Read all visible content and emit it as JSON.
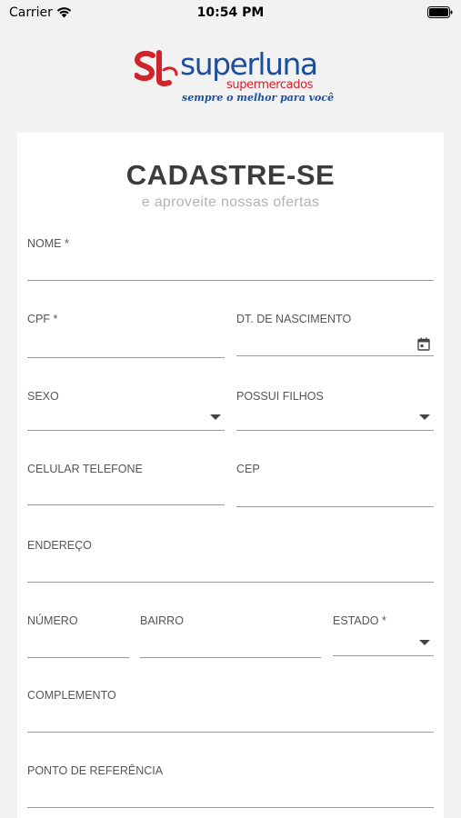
{
  "status_bar": {
    "carrier": "Carrier",
    "time": "10:54 PM",
    "wifi_icon": "wifi-icon",
    "battery_icon": "battery-icon"
  },
  "logo": {
    "name": "superluna",
    "sub": "supermercados",
    "slogan": "sempre o melhor para você",
    "mark_letters": "SL",
    "colors": {
      "red": "#d1232a",
      "blue": "#1d4e9c"
    }
  },
  "form": {
    "title": "CADASTRE-SE",
    "subtitle": "e aproveite nossas ofertas",
    "fields": {
      "nome": {
        "label": "NOME *",
        "value": ""
      },
      "cpf": {
        "label": "CPF *",
        "value": ""
      },
      "nascimento": {
        "label": "DT. DE NASCIMENTO",
        "value": "",
        "icon": "calendar-icon"
      },
      "sexo": {
        "label": "SEXO",
        "value": "",
        "icon": "dropdown-arrow-icon"
      },
      "filhos": {
        "label": "POSSUI FILHOS",
        "value": "",
        "icon": "dropdown-arrow-icon"
      },
      "celular": {
        "label": "CELULAR TELEFONE",
        "value": ""
      },
      "cep": {
        "label": "CEP",
        "value": ""
      },
      "endereco": {
        "label": "ENDEREÇO",
        "value": ""
      },
      "numero": {
        "label": "NÚMERO",
        "value": ""
      },
      "bairro": {
        "label": "BAIRRO",
        "value": ""
      },
      "estado": {
        "label": "ESTADO *",
        "value": "",
        "icon": "dropdown-arrow-icon"
      },
      "complemento": {
        "label": "COMPLEMENTO",
        "value": ""
      },
      "referencia": {
        "label": "PONTO DE REFERÊNCIA",
        "value": ""
      }
    }
  }
}
